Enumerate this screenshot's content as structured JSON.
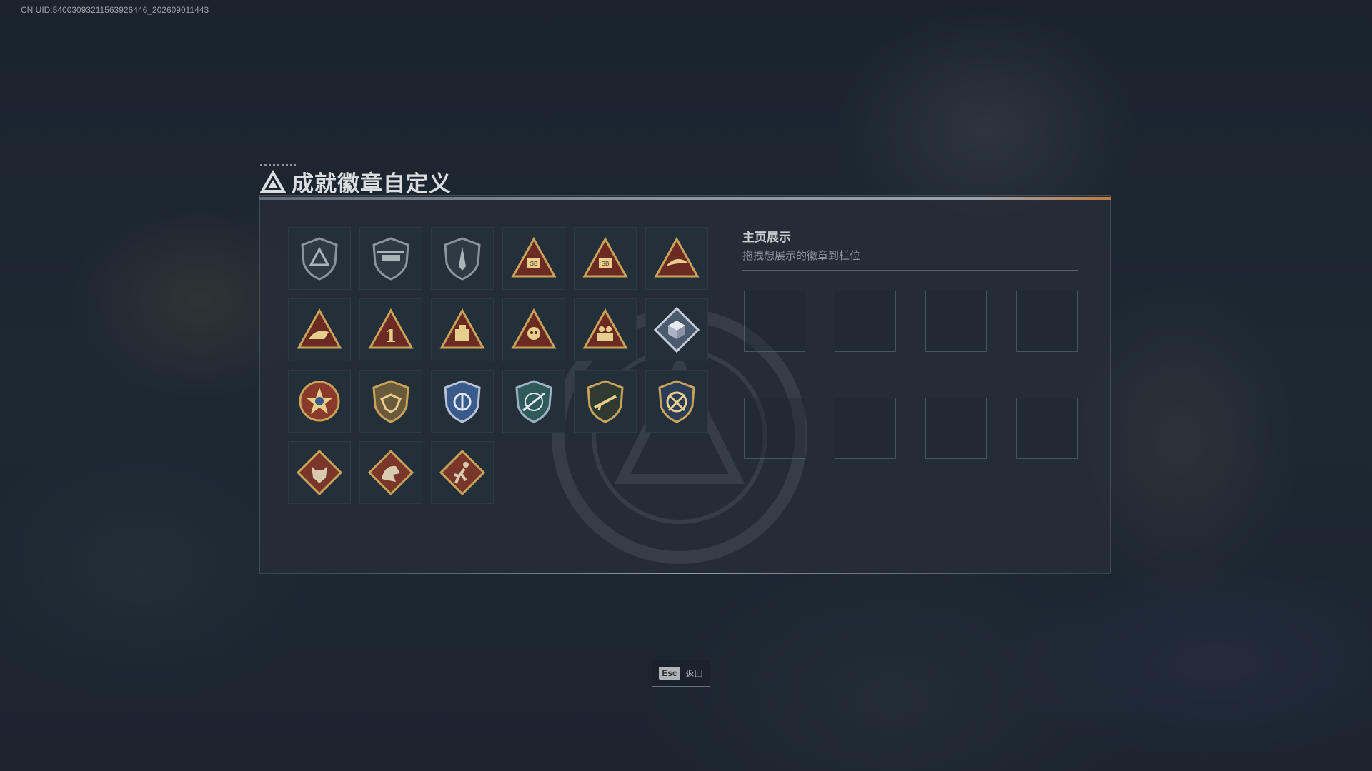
{
  "uid_text": "CN UID:54003093211563926446_202609011443",
  "title": "成就徽章自定义",
  "showcase": {
    "heading": "主页展示",
    "hint": "拖拽想展示的徽章到栏位",
    "slot_count": 8
  },
  "esc": {
    "key": "Esc",
    "label": "返回"
  },
  "badges": [
    {
      "icon": "triangle-shield-icon"
    },
    {
      "icon": "helicopter-shield-icon"
    },
    {
      "icon": "dagger-shield-icon"
    },
    {
      "icon": "sb-triangle-icon"
    },
    {
      "icon": "sb-crossed-triangle-icon"
    },
    {
      "icon": "bird-triangle-icon"
    },
    {
      "icon": "dragon-triangle-icon"
    },
    {
      "icon": "number-one-triangle-icon"
    },
    {
      "icon": "crate-triangle-icon"
    },
    {
      "icon": "skull-triangle-icon"
    },
    {
      "icon": "soldiers-triangle-icon"
    },
    {
      "icon": "cube-diamond-icon"
    },
    {
      "icon": "star-medal-icon"
    },
    {
      "icon": "eagle-shield-icon"
    },
    {
      "icon": "police-badge-icon"
    },
    {
      "icon": "crosshair-shield-icon"
    },
    {
      "icon": "rifle-shield-icon"
    },
    {
      "icon": "sword-crest-icon"
    },
    {
      "icon": "wolf-diamond-icon"
    },
    {
      "icon": "dragon-diamond-icon"
    },
    {
      "icon": "runner-diamond-icon"
    }
  ],
  "colors": {
    "gold": "#c9a25a",
    "dark_red": "#6b2a22",
    "steel": "#8a949c",
    "blue": "#3b5a8c"
  }
}
